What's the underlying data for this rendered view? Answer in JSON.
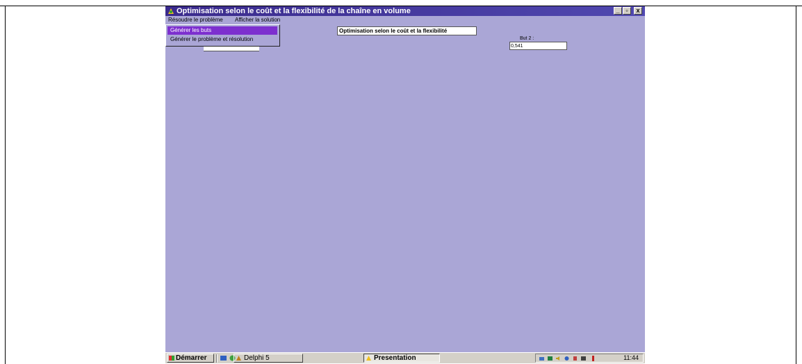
{
  "window": {
    "title": "Optimisation selon le coût et la flexibilité de la chaîne en volume",
    "buttons": {
      "minimize": "_",
      "maximize": "▫",
      "close": "x"
    }
  },
  "menubar": {
    "resoudre": "Résoudre le problème",
    "afficher": "Afficher la solution"
  },
  "dropdown": {
    "items": [
      "Générer les buts",
      "Générer le problème et résolution"
    ]
  },
  "form": {
    "heading": "Optimisation selon le coût et la flexibilité",
    "but2_label": "But 2 :",
    "but2_value": "0,541"
  },
  "taskbar": {
    "start": "Démarrer",
    "tasks": [
      "Delphi 5",
      "Presentation"
    ],
    "clock": "11:44"
  },
  "colors": {
    "desktop": "#aaa6d6",
    "titlebar": "#3a2a8c",
    "highlight": "#7d2fcf"
  }
}
